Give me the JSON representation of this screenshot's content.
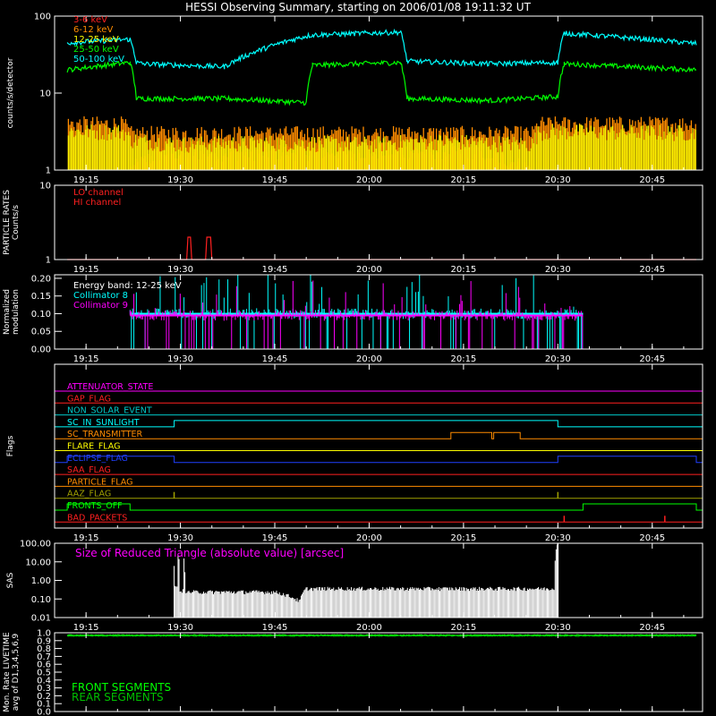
{
  "title": "HESSI Observing Summary, starting on 2006/01/08 19:11:32 UT",
  "colors": {
    "background": "#000000",
    "axis": "#ffffff",
    "band_3_6": "#ff2020",
    "band_6_12": "#ff8c00",
    "band_12_25": "#ffff00",
    "band_25_50": "#00ff00",
    "band_50_100": "#00ffff",
    "lo_channel": "#ff2020",
    "hi_channel": "#ff2020",
    "collimator_8": "#00ffff",
    "collimator_9": "#ff00ff",
    "sas": "#ffffff",
    "sas_label": "#ff00ff",
    "front_segments": "#00ff00",
    "rear_segments": "#00c000"
  },
  "time_axis": {
    "unit": "UT (hh:mm) on 2006/01/08",
    "range": [
      "19:10",
      "20:53"
    ],
    "tick_labels": [
      "19:15",
      "19:30",
      "19:45",
      "20:00",
      "20:15",
      "20:30",
      "20:45"
    ]
  },
  "chart_data": [
    {
      "id": "count_rates",
      "type": "line",
      "ylabel": "counts/s/detector",
      "yscale": "log",
      "ylim": [
        1,
        100
      ],
      "y_tick_labels": [
        "1",
        "10",
        "100"
      ],
      "legend": {
        "placement": "top-left",
        "entries": [
          "3-6 keV",
          "6-12 keV",
          "12-25 keV",
          "25-50 keV",
          "50-100 keV"
        ]
      },
      "series": [
        {
          "name": "50-100 keV",
          "color": "#00ffff",
          "x": [
            "19:12",
            "19:22",
            "19:23",
            "19:24",
            "19:37",
            "19:50",
            "19:51",
            "20:05",
            "20:06",
            "20:19",
            "20:30",
            "20:31",
            "20:52"
          ],
          "y": [
            45,
            50,
            25,
            24,
            22,
            55,
            57,
            62,
            26,
            24,
            25,
            60,
            44
          ]
        },
        {
          "name": "25-50 keV",
          "color": "#00ff00",
          "x": [
            "19:12",
            "19:22",
            "19:23",
            "19:37",
            "19:50",
            "19:51",
            "20:05",
            "20:06",
            "20:19",
            "20:30",
            "20:31",
            "20:52"
          ],
          "y": [
            20,
            25,
            8.5,
            8.5,
            7.5,
            23,
            25,
            8.5,
            8,
            9,
            24,
            20
          ]
        },
        {
          "name": "12-25 keV",
          "color": "#ffff00",
          "x": [
            "19:12",
            "19:21",
            "19:22",
            "19:30",
            "19:45",
            "20:00",
            "20:10",
            "20:26",
            "20:27",
            "20:52"
          ],
          "y": [
            3.2,
            3.2,
            2.5,
            2.2,
            2.3,
            2.2,
            2.4,
            2.2,
            3.2,
            3.1
          ]
        },
        {
          "name": "6-12 keV",
          "color": "#ff8c00",
          "x": [
            "19:12",
            "19:21",
            "19:22",
            "20:26",
            "20:27",
            "20:52"
          ],
          "y": [
            4,
            4,
            3,
            3,
            4,
            4
          ]
        },
        {
          "name": "3-6 keV",
          "color": "#ff2020",
          "x": [
            "19:12",
            "19:22",
            "19:27",
            "19:31",
            "20:12",
            "20:17",
            "20:26",
            "20:52"
          ],
          "y": [
            1,
            1,
            1.7,
            1.7,
            1.8,
            1.8,
            1,
            1
          ]
        }
      ]
    },
    {
      "id": "particle_rates",
      "type": "line",
      "ylabel": "PARTICLE RATES\nCounts/s",
      "yscale": "log",
      "ylim": [
        1,
        10
      ],
      "y_tick_labels": [
        "1",
        "10"
      ],
      "legend": {
        "placement": "top-left",
        "entries": [
          "LO channel",
          "HI channel"
        ]
      },
      "series": [
        {
          "name": "HI channel",
          "color": "#ff2020",
          "x": [
            "19:12",
            "19:31",
            "19:31.2",
            "19:31.6",
            "19:31.8",
            "19:34",
            "19:34.2",
            "19:34.8",
            "19:35",
            "20:52"
          ],
          "y": [
            1,
            1,
            2,
            2,
            1,
            1,
            2,
            2,
            1,
            1
          ]
        }
      ]
    },
    {
      "id": "modulation",
      "type": "line",
      "ylabel": "Normalized\nmodulation",
      "ylim": [
        0,
        0.21
      ],
      "y_tick_labels": [
        "0.00",
        "0.05",
        "0.10",
        "0.15",
        "0.20"
      ],
      "legend": {
        "placement": "top-left",
        "entries": [
          "Energy band: 12-25 keV",
          "Collimator 8",
          "Collimator 9"
        ]
      },
      "active_interval": [
        "19:22",
        "20:34"
      ],
      "series": [
        {
          "name": "Collimator 8",
          "color": "#00ffff",
          "typical": 0.1,
          "spread": 0.12
        },
        {
          "name": "Collimator 9",
          "color": "#ff00ff",
          "typical": 0.095,
          "spread": 0.1
        }
      ]
    },
    {
      "id": "flags",
      "type": "line",
      "ylabel": "Flags",
      "rows": [
        {
          "name": "ATTENUATOR_STATE",
          "color": "#ff00ff",
          "segments": []
        },
        {
          "name": "GAP_FLAG",
          "color": "#ff2020",
          "segments": []
        },
        {
          "name": "NON_SOLAR_EVENT",
          "color": "#00c8c8",
          "segments": []
        },
        {
          "name": "SC_IN_SUNLIGHT",
          "color": "#00ffff",
          "segments": [
            [
              "19:29",
              "20:30"
            ]
          ]
        },
        {
          "name": "SC_TRANSMITTER",
          "color": "#ff8c00",
          "segments": [
            [
              "20:13",
              "20:19.5"
            ],
            [
              "20:19.8",
              "20:24"
            ]
          ]
        },
        {
          "name": "FLARE_FLAG",
          "color": "#ffff00",
          "segments": []
        },
        {
          "name": "ECLIPSE_FLAG",
          "color": "#2040ff",
          "segments": [
            [
              "19:12",
              "19:29"
            ],
            [
              "20:30",
              "20:52"
            ]
          ]
        },
        {
          "name": "SAA_FLAG",
          "color": "#ff2020",
          "segments": []
        },
        {
          "name": "PARTICLE_FLAG",
          "color": "#ff8c00",
          "segments": []
        },
        {
          "name": "AAZ_FLAG",
          "color": "#a0a000",
          "spikes": [
            "19:29",
            "20:30"
          ]
        },
        {
          "name": "FRONTS_OFF",
          "color": "#00ff00",
          "segments": [
            [
              "19:12",
              "19:22"
            ],
            [
              "20:34",
              "20:52"
            ]
          ]
        },
        {
          "name": "BAD_PACKETS",
          "color": "#ff2020",
          "spikes": [
            "20:31",
            "20:47"
          ]
        }
      ]
    },
    {
      "id": "sas",
      "type": "line",
      "ylabel": "SAS",
      "yscale": "log",
      "ylim": [
        0.01,
        100
      ],
      "y_tick_labels": [
        "0.01",
        "0.10",
        "1.00",
        "10.00",
        "100.00"
      ],
      "annotation": "Size of Reduced Triangle (absolute value) [arcsec]",
      "series": [
        {
          "name": "SAS",
          "color": "#ffffff",
          "x": [
            "19:29",
            "19:30",
            "19:31",
            "19:45",
            "19:49",
            "19:50",
            "20:29.5",
            "20:30"
          ],
          "y": [
            0.5,
            0.25,
            0.2,
            0.2,
            0.06,
            0.3,
            0.3,
            100
          ]
        }
      ]
    },
    {
      "id": "livetime",
      "type": "line",
      "ylabel": "Mon. Rate LIVETIME\navg of D1,3,4,5,6,9",
      "ylim": [
        0,
        1
      ],
      "y_tick_labels": [
        "0.0",
        "0.1",
        "0.2",
        "0.3",
        "0.4",
        "0.5",
        "0.6",
        "0.7",
        "0.8",
        "0.9",
        "1.0"
      ],
      "legend": {
        "placement": "bottom-left",
        "entries": [
          "FRONT SEGMENTS",
          "REAR SEGMENTS"
        ]
      },
      "series": [
        {
          "name": "FRONT SEGMENTS",
          "color": "#00ff00",
          "x": [
            "19:12",
            "20:52"
          ],
          "y": [
            0.97,
            0.97
          ]
        },
        {
          "name": "REAR SEGMENTS",
          "color": "#00c000",
          "x": [
            "19:12",
            "20:52"
          ],
          "y": [
            0.96,
            0.96
          ]
        }
      ]
    }
  ]
}
